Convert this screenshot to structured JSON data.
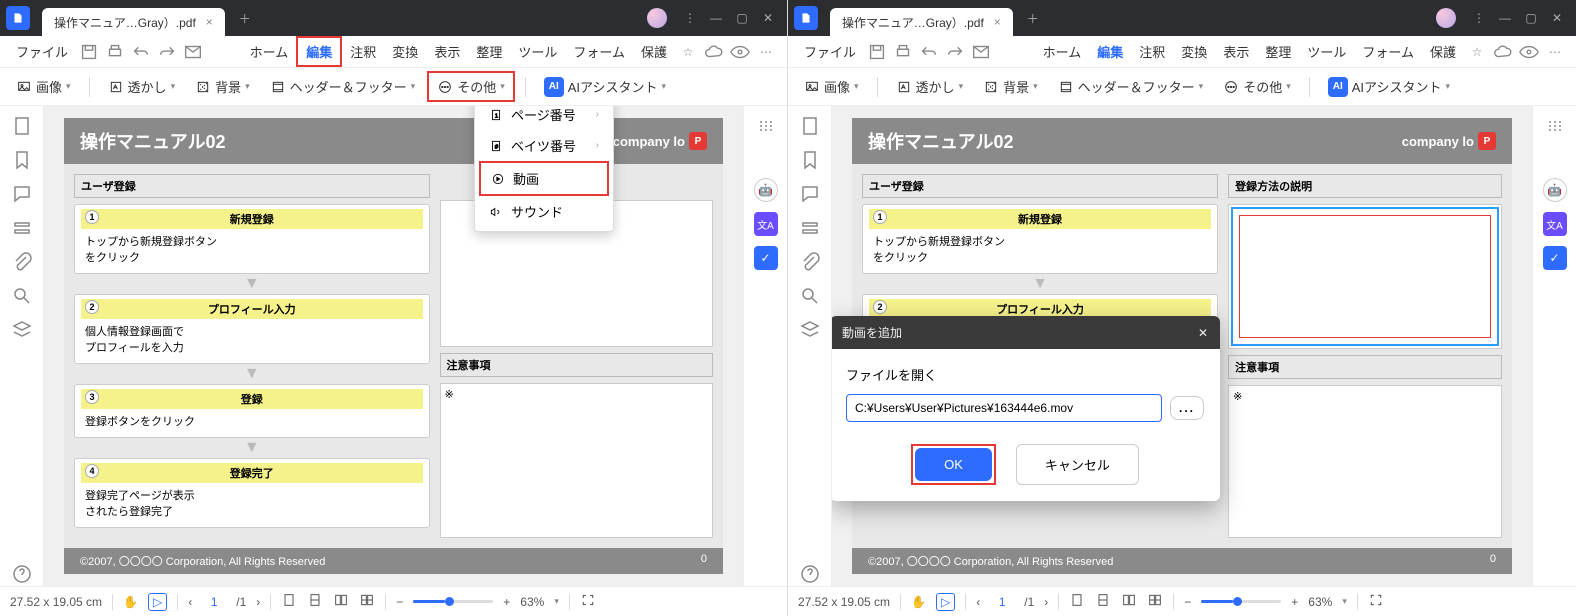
{
  "app": {
    "title": "操作マニュア…Gray）.pdf"
  },
  "menubar": {
    "file": "ファイル",
    "home": "ホーム",
    "edit": "編集",
    "annotate": "注釈",
    "convert": "変換",
    "display": "表示",
    "organize": "整理",
    "tool": "ツール",
    "form": "フォーム",
    "protect": "保護"
  },
  "toolbar": {
    "image": "画像",
    "watermark": "透かし",
    "background": "背景",
    "header_footer": "ヘッダー＆フッター",
    "other": "その他",
    "ai": "AI",
    "ai_assistant": "AIアシスタント"
  },
  "dropdown": {
    "page_number": "ページ番号",
    "bates_number": "ベイツ番号",
    "video": "動画",
    "sound": "サウンド"
  },
  "dialog": {
    "title": "動画を追加",
    "open_file": "ファイルを開く",
    "path": "C:¥Users¥User¥Pictures¥163444e6.mov",
    "browse": "...",
    "ok": "OK",
    "cancel": "キャンセル"
  },
  "document": {
    "title": "操作マニュアル02",
    "company_logo": "company lo",
    "user_reg": "ユーザ登録",
    "step1_title": "新規登録",
    "step1_body1": "トップから新規登録ボタン",
    "step1_body2": "をクリック",
    "step2_title": "プロフィール入力",
    "step2_body1": "個人情報登録画面で",
    "step2_body2": "プロフィールを入力",
    "step3_title": "登録",
    "step3_body": "登録ボタンをクリック",
    "step4_title": "登録完了",
    "step4_body1": "登録完了ページが表示",
    "step4_body2": "されたら登録完了",
    "reg_method": "登録方法の説明",
    "notes_title": "注意事項",
    "notes_mark": "※",
    "footer_left": "©2007, 〇〇〇〇 Corporation, All Rights Reserved",
    "footer_right": "0",
    "logo_p": "P"
  },
  "statusbar": {
    "coords": "27.52 x 19.05 cm",
    "page": "1",
    "total": "/1",
    "zoom": "63%"
  }
}
